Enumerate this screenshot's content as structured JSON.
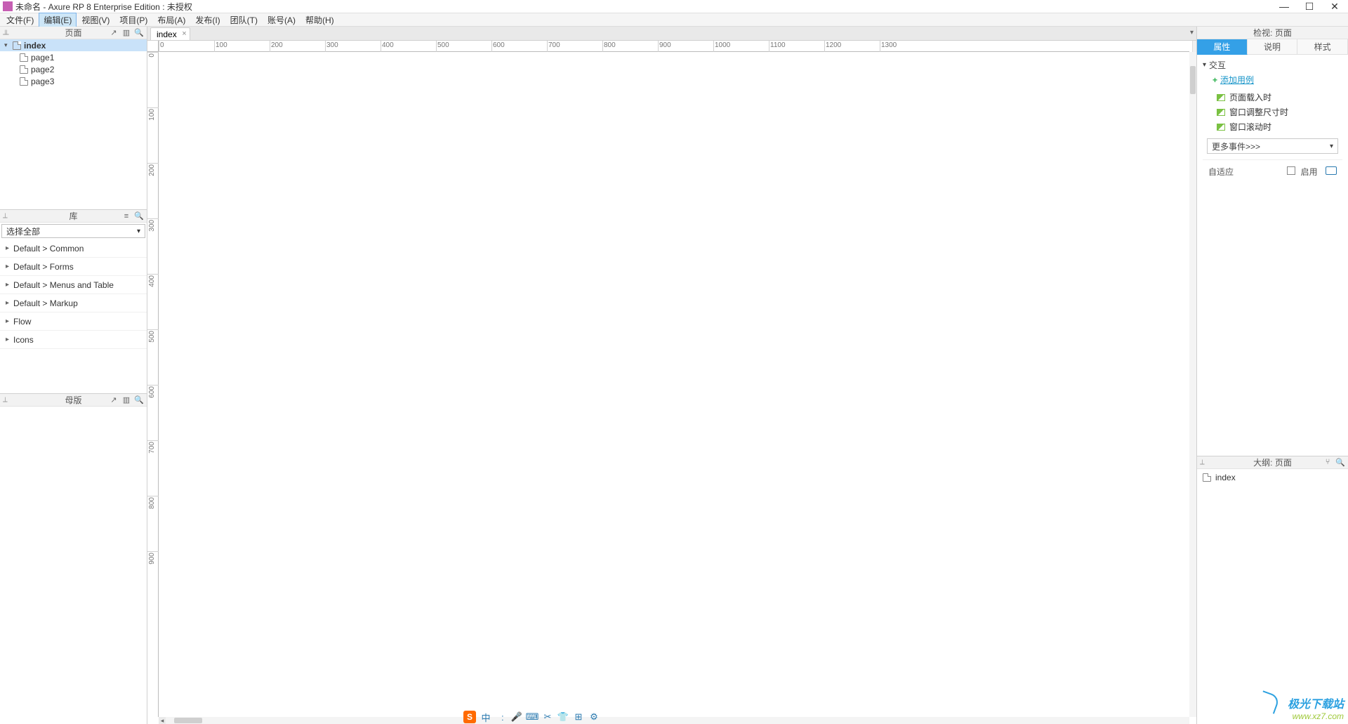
{
  "window": {
    "title": "未命名 - Axure RP 8 Enterprise Edition : 未授权"
  },
  "menus": [
    "文件(F)",
    "编辑(E)",
    "视图(V)",
    "项目(P)",
    "布局(A)",
    "发布(I)",
    "团队(T)",
    "账号(A)",
    "帮助(H)"
  ],
  "menu_selected_index": 1,
  "left": {
    "pages": {
      "title": "页面",
      "root": "index",
      "children": [
        "page1",
        "page2",
        "page3"
      ]
    },
    "library": {
      "title": "库",
      "selector": "选择全部",
      "categories": [
        "Default > Common",
        "Default > Forms",
        "Default > Menus and Table",
        "Default > Markup",
        "Flow",
        "Icons"
      ]
    },
    "masters": {
      "title": "母版"
    }
  },
  "center": {
    "tab": "index",
    "hruler": [
      0,
      100,
      200,
      300,
      400,
      500,
      600,
      700,
      800,
      900,
      1000,
      1100,
      1200,
      1300
    ],
    "vruler": [
      0,
      100,
      200,
      300,
      400,
      500,
      600,
      700,
      800,
      900
    ]
  },
  "right": {
    "inspector_title": "检视: 页面",
    "tabs": [
      "属性",
      "说明",
      "样式"
    ],
    "active_tab": 0,
    "interaction": {
      "title": "交互",
      "add_case": "添加用例",
      "events": [
        "页面载入时",
        "窗口调整尺寸时",
        "窗口滚动时"
      ],
      "more": "更多事件>>>"
    },
    "adaptive": {
      "label": "自适应",
      "enable": "启用"
    },
    "outline": {
      "title": "大纲: 页面",
      "root": "index"
    }
  },
  "ime": {
    "badge": "S",
    "lang": "中"
  },
  "watermark": {
    "line1": "极光下载站",
    "line2": "www.xz7.com"
  }
}
